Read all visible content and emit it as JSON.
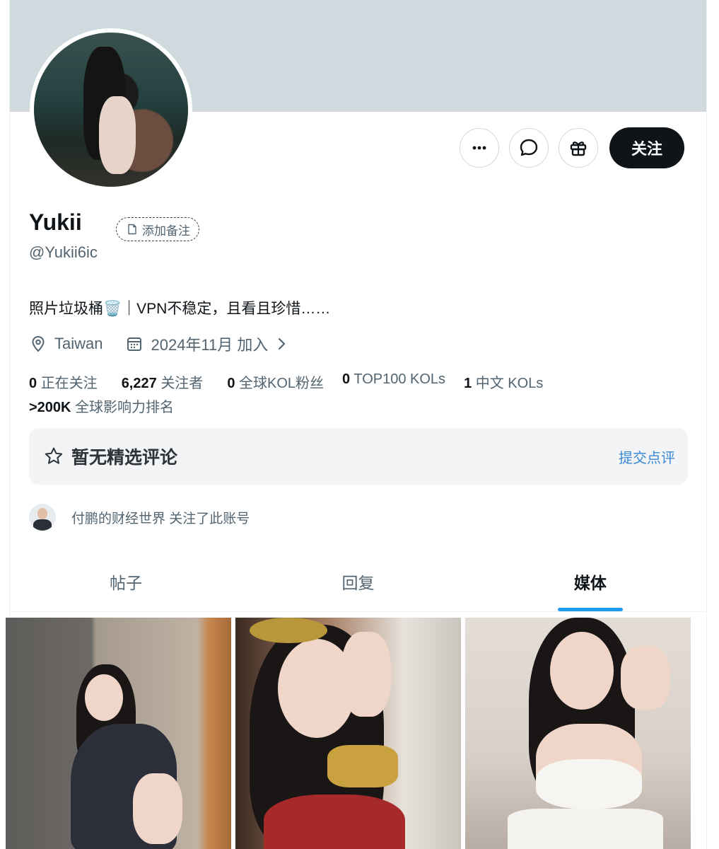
{
  "profile": {
    "name": "Yukii",
    "handle": "@Yukii6ic",
    "add_note_label": "添加备注",
    "bio": "照片垃圾桶🗑️｜VPN不稳定，且看且珍惜……",
    "location": "Taiwan",
    "joined": "2024年11月 加入"
  },
  "actions": {
    "more_icon": "more-horizontal-icon",
    "message_icon": "message-icon",
    "gift_icon": "gift-icon",
    "follow_label": "关注"
  },
  "stats": {
    "following_count": "0",
    "following_label": "正在关注",
    "followers_count": "6,227",
    "followers_label": "关注者",
    "kol_fans_count": "0",
    "kol_fans_label": "全球KOL粉丝",
    "top100_count": "0",
    "top100_label": "TOP100 KOLs",
    "chinese_kols_count": "1",
    "chinese_kols_label": "中文 KOLs",
    "rank_value": ">200K",
    "rank_label": "全球影响力排名"
  },
  "review": {
    "title": "暂无精选评论",
    "submit_label": "提交点评"
  },
  "followed_by": {
    "text": "付鹏的财经世界 关注了此账号"
  },
  "tabs": [
    {
      "label": "帖子",
      "active": false
    },
    {
      "label": "回复",
      "active": false
    },
    {
      "label": "媒体",
      "active": true
    }
  ],
  "colors": {
    "banner": "#cfd9de",
    "accent": "#1d9bf0",
    "link": "#3b88d4",
    "primary_button": "#0f1419"
  }
}
